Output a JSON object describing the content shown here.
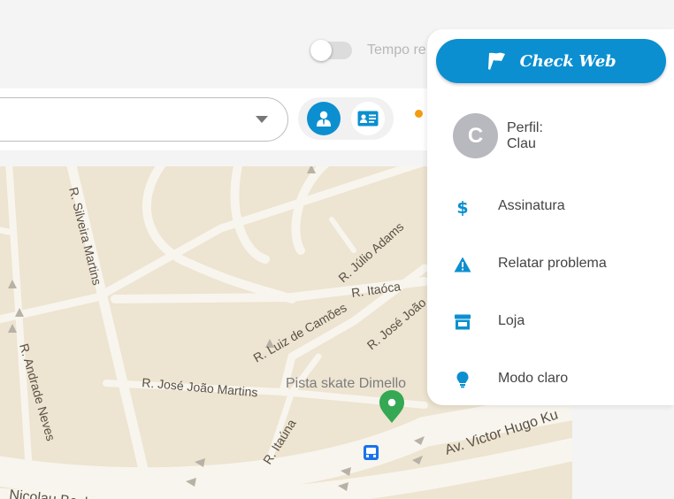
{
  "top": {
    "toggle_label": "Tempo re"
  },
  "search": {
    "value": ""
  },
  "map": {
    "streets": [
      "R. Luiz de Camões",
      "R. Silveira Martins",
      "R. Júlio Adams",
      "R. Itaóca",
      "R. José João",
      "R. Andrade Neves",
      "R. José João Martins",
      "R. Itaúna",
      "Av. Victor Hugo Ku",
      "Nicolau Becker"
    ],
    "poi": "Pista skate Dimello"
  },
  "menu": {
    "check_web_label": "Check Web",
    "profile": {
      "avatar_initial": "C",
      "label": "Perfil:",
      "name": "Clau"
    },
    "items": [
      {
        "label": "Assinatura",
        "icon": "dollar-icon"
      },
      {
        "label": "Relatar problema",
        "icon": "warning-icon"
      },
      {
        "label": "Loja",
        "icon": "store-icon"
      },
      {
        "label": "Modo claro",
        "icon": "lightbulb-icon"
      }
    ]
  },
  "colors": {
    "accent": "#0b8fd0",
    "map_background": "#ede4d1",
    "road": "#f8f5ee",
    "status_dot": "#f39c12",
    "poi_pin": "#34a853"
  }
}
